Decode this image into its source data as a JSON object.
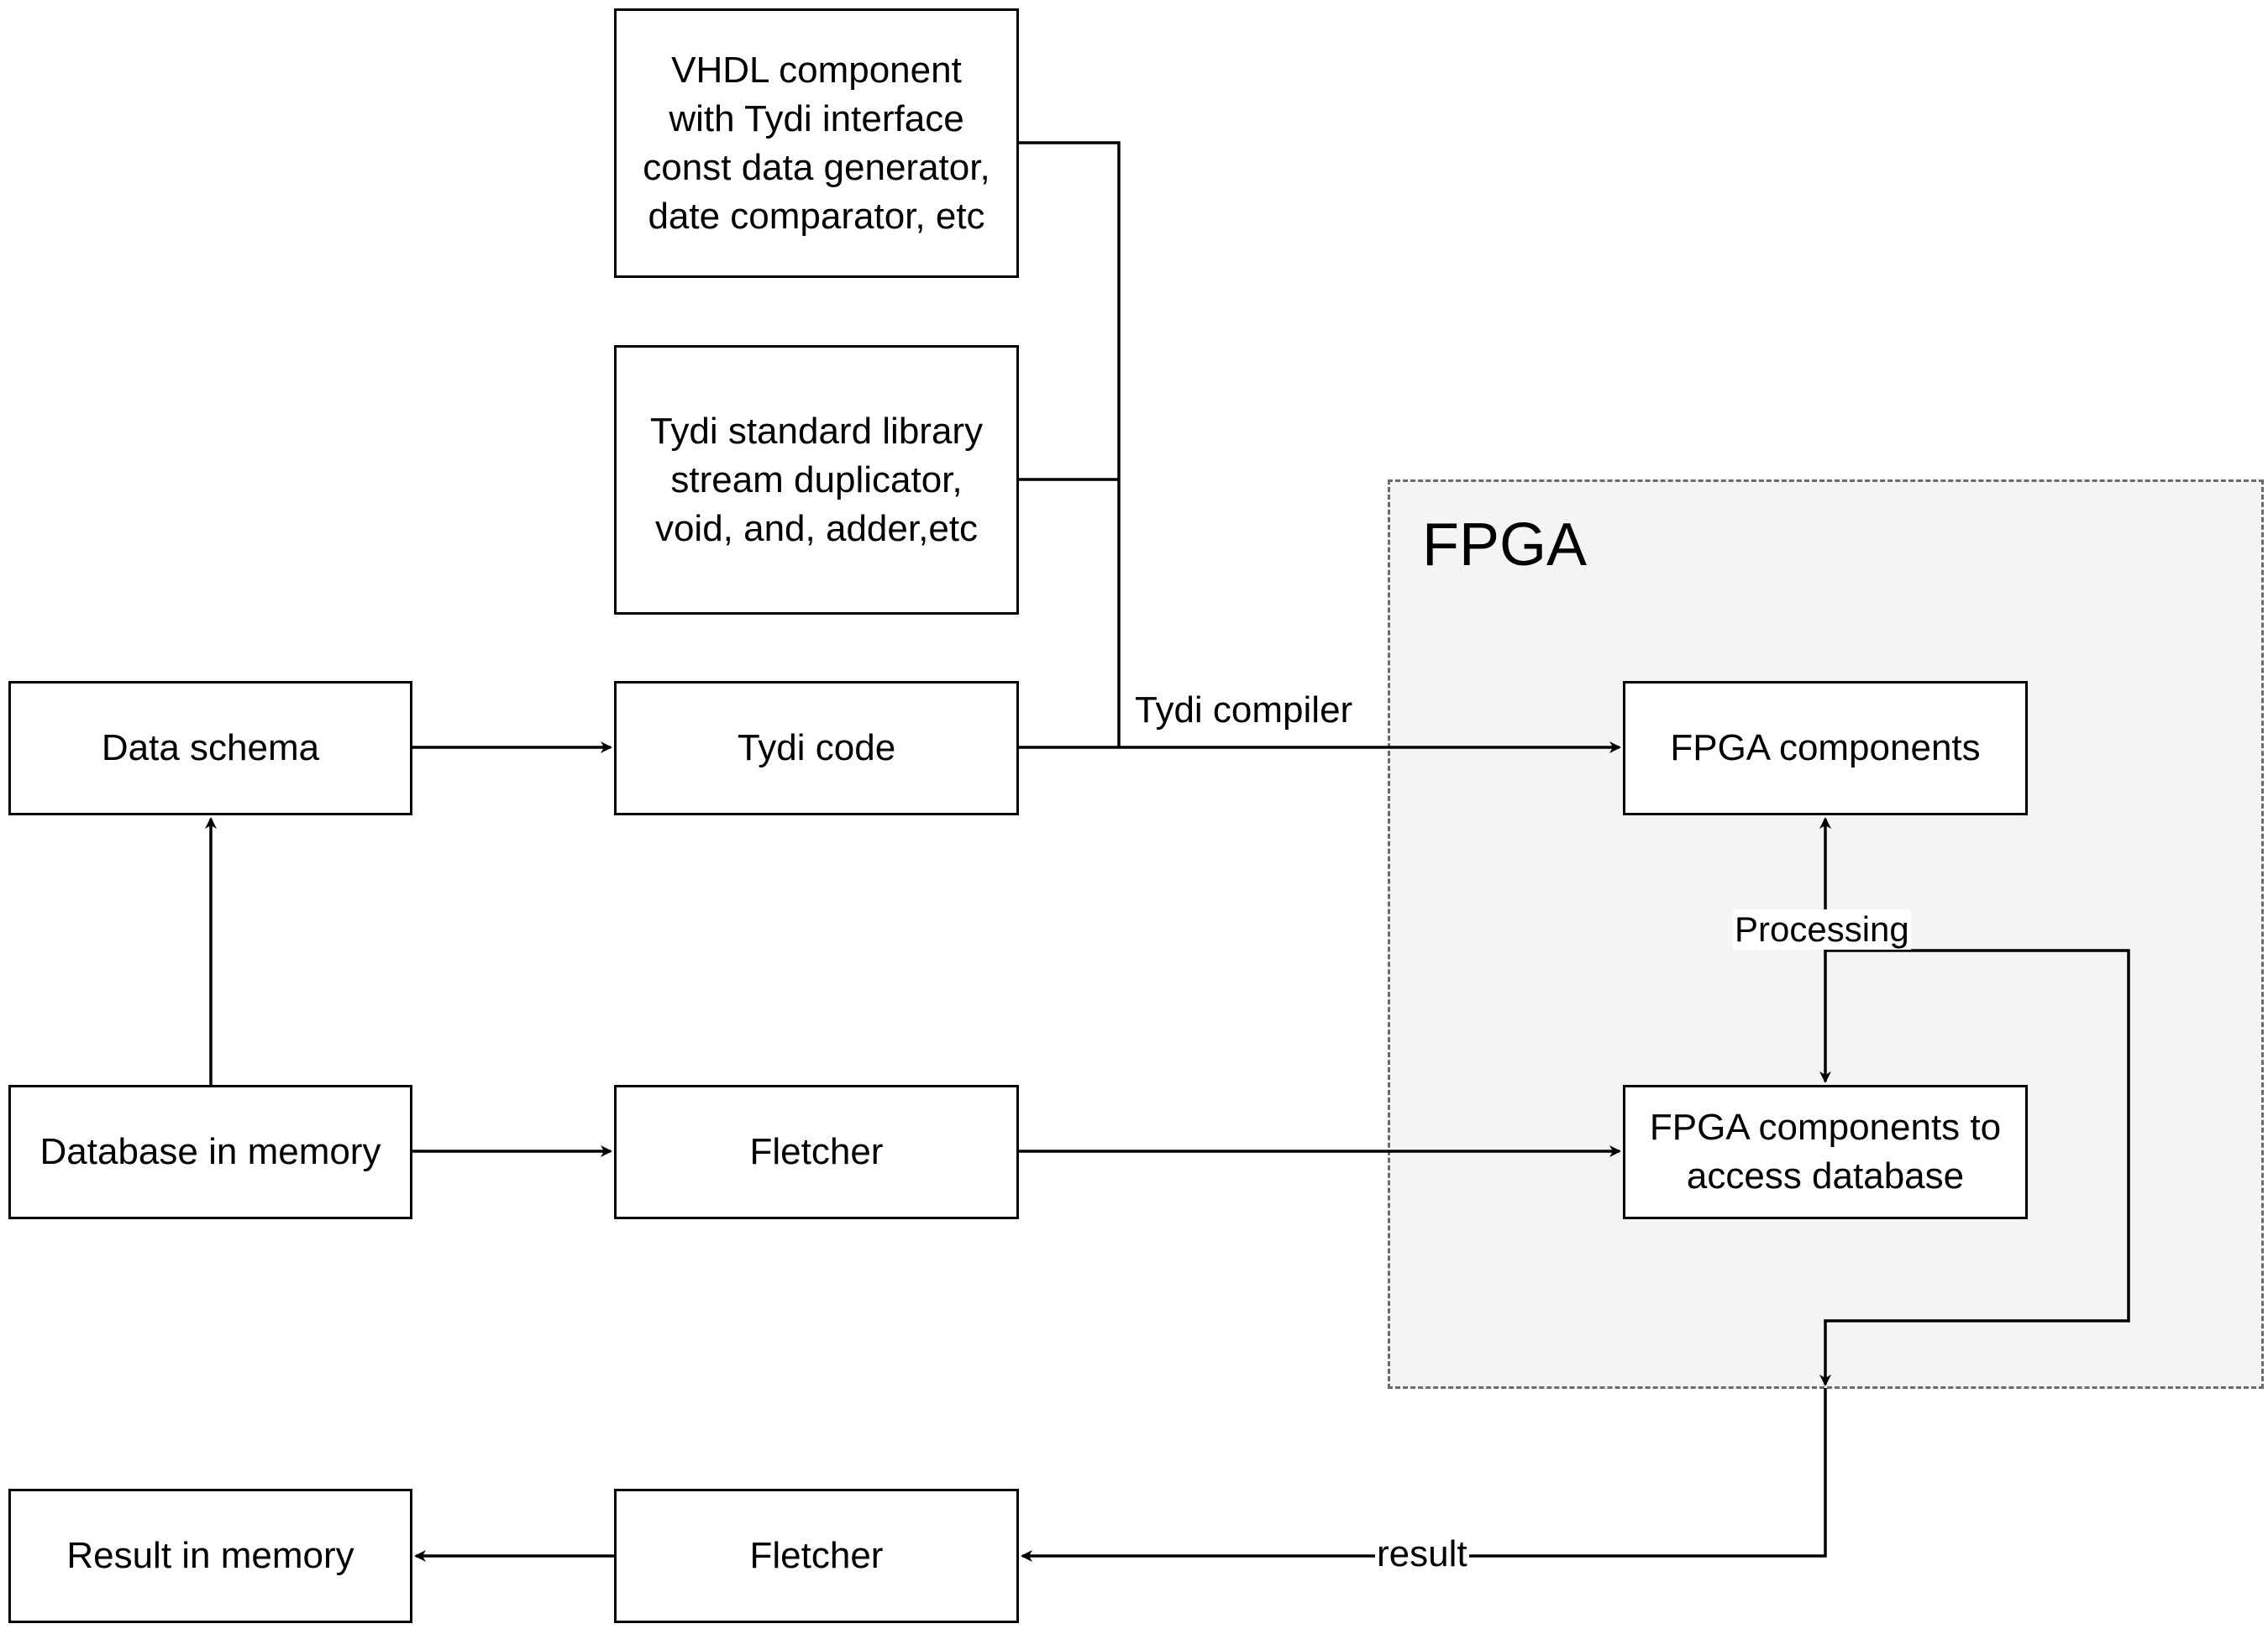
{
  "container": {
    "title": "FPGA"
  },
  "nodes": {
    "vhdl": "VHDL component\nwith Tydi interface\nconst data generator,\ndate comparator, etc",
    "stdlib": "Tydi standard library\nstream duplicator,\nvoid, and, adder,etc",
    "data_schema": "Data schema",
    "tydi_code": "Tydi code",
    "fpga_components": "FPGA components",
    "db_memory": "Database in memory",
    "fletcher_in": "Fletcher",
    "fpga_access": "FPGA components to\naccess database",
    "result_memory": "Result in memory",
    "fletcher_out": "Fletcher"
  },
  "edges": {
    "compiler": "Tydi compiler",
    "processing": "Processing",
    "result": "result"
  },
  "colors": {
    "stroke": "#000000",
    "container_fill": "#f4f4f4",
    "container_border": "#6b6b6b"
  }
}
